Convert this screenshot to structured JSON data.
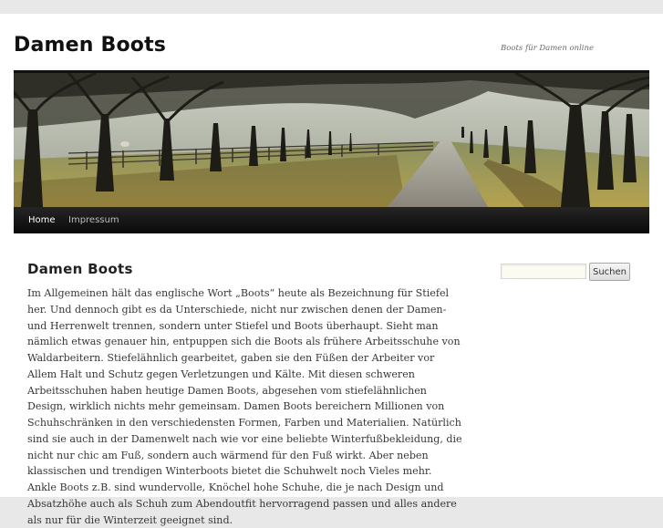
{
  "site": {
    "title": "Damen Boots",
    "description": "Boots für Damen online"
  },
  "banner": {
    "image": "tree-lined avenue with path and fence"
  },
  "nav": {
    "items": [
      {
        "label": "Home",
        "active": true
      },
      {
        "label": "Impressum",
        "active": false
      }
    ]
  },
  "article": {
    "title": "Damen Boots",
    "body": "Im Allgemeinen hält das englische Wort „Boots“ heute als Bezeichnung für Stiefel her. Und dennoch gibt es da Unterschiede, nicht nur zwischen denen der Damen- und Herrenwelt trennen, sondern unter Stiefel und Boots überhaupt. Sieht man nämlich etwas genauer hin, entpuppen sich die Boots als frühere Arbeitsschuhe von Waldarbeitern. Stiefelähnlich gearbeitet, gaben sie den Füßen der Arbeiter vor Allem Halt und Schutz gegen Verletzungen und Kälte. Mit diesen schweren Arbeitsschuhen haben heutige Damen Boots, abgesehen vom stiefelähnlichen Design, wirklich nichts mehr gemeinsam. Damen Boots bereichern Millionen von Schuhschränken in den verschiedensten Formen, Farben und Materialien. Natürlich sind sie auch in der Damenwelt nach wie vor eine beliebte Winterfußbekleidung, die nicht nur chic am Fuß, sondern auch wärmend für den Fuß wirkt. Aber neben klassischen und trendigen Winterboots bietet die Schuhwelt noch Vieles mehr. Ankle Boots z.B. sind wundervolle, Knöchel hohe Schuhe, die je nach Design und Absatzhöhe auch als Schuh zum Abendoutfit hervorragend passen und alles andere als nur für die Winterzeit geeignet sind."
  },
  "search": {
    "value": "",
    "button_label": "Suchen"
  }
}
